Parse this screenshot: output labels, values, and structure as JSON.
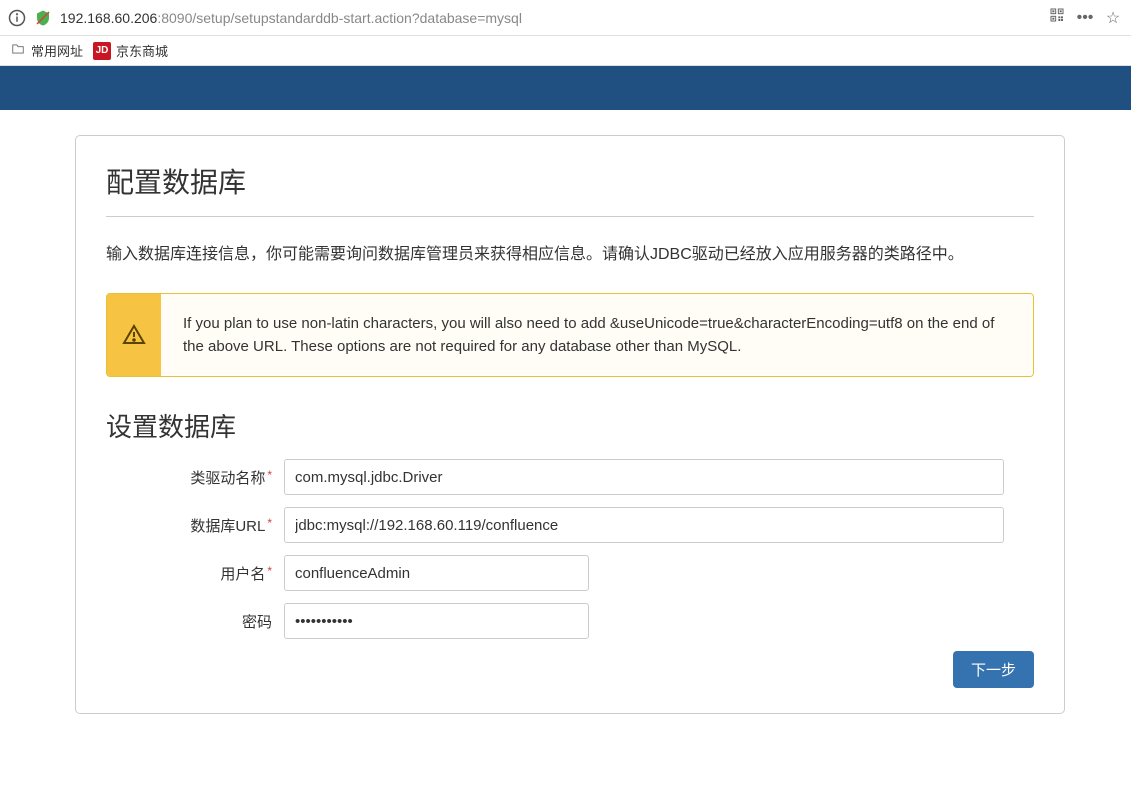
{
  "browser": {
    "url_host": "192.168.60.206",
    "url_path": ":8090/setup/setupstandarddb-start.action?database=mysql"
  },
  "bookmarks": {
    "b1": "常用网址",
    "b2": "京东商城"
  },
  "page": {
    "title": "配置数据库",
    "intro": "输入数据库连接信息，你可能需要询问数据库管理员来获得相应信息。请确认JDBC驱动已经放入应用服务器的类路径中。",
    "warning": "If you plan to use non-latin characters, you will also need to add &useUnicode=true&characterEncoding=utf8 on the end of the above URL. These options are not required for any database other than MySQL.",
    "section_title": "设置数据库"
  },
  "form": {
    "driver": {
      "label": "类驱动名称",
      "value": "com.mysql.jdbc.Driver"
    },
    "dburl": {
      "label": "数据库URL",
      "value": "jdbc:mysql://192.168.60.119/confluence"
    },
    "user": {
      "label": "用户名",
      "value": "confluenceAdmin"
    },
    "password": {
      "label": "密码",
      "value": "•••••••••••"
    },
    "next_button": "下一步"
  }
}
